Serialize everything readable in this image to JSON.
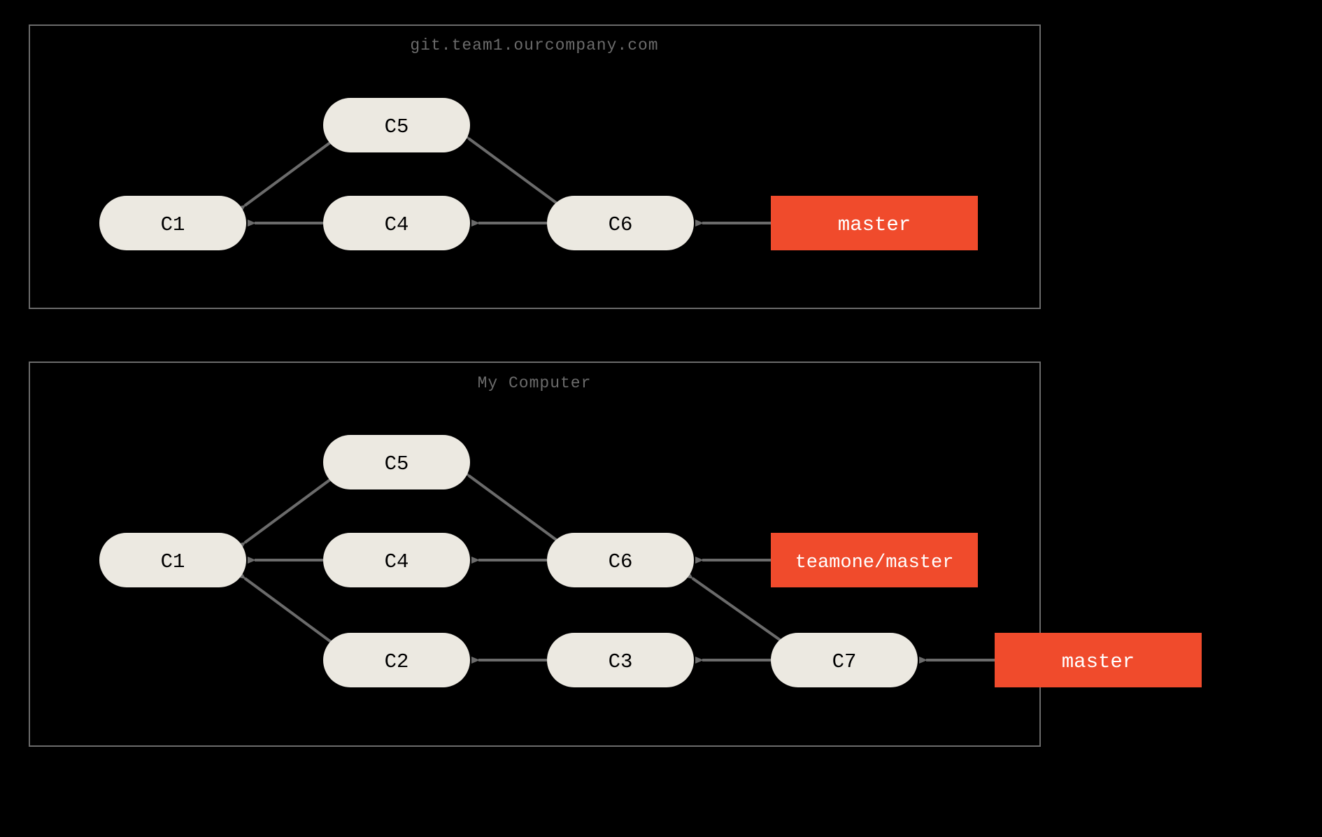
{
  "colors": {
    "background": "#000000",
    "panel_border": "#6b6b6b",
    "edge": "#6b6b6b",
    "commit_fill": "#ece9e1",
    "commit_text": "#000000",
    "branch_fill": "#f04b2c",
    "branch_text": "#ffffff",
    "title_text": "#6b6b6b"
  },
  "top_panel": {
    "title": "git.team1.ourcompany.com",
    "commits": {
      "c1": "C1",
      "c4": "C4",
      "c5": "C5",
      "c6": "C6"
    },
    "branches": {
      "master": "master"
    },
    "edges": [
      [
        "c4",
        "c1"
      ],
      [
        "c5",
        "c1"
      ],
      [
        "c6",
        "c4"
      ],
      [
        "c6",
        "c5"
      ],
      [
        "master",
        "c6"
      ]
    ]
  },
  "bottom_panel": {
    "title": "My Computer",
    "commits": {
      "c1": "C1",
      "c2": "C2",
      "c3": "C3",
      "c4": "C4",
      "c5": "C5",
      "c6": "C6",
      "c7": "C7"
    },
    "branches": {
      "teamone_master": "teamone/master",
      "master": "master"
    },
    "edges": [
      [
        "c4",
        "c1"
      ],
      [
        "c5",
        "c1"
      ],
      [
        "c2",
        "c1"
      ],
      [
        "c6",
        "c4"
      ],
      [
        "c6",
        "c5"
      ],
      [
        "c3",
        "c2"
      ],
      [
        "c7",
        "c3"
      ],
      [
        "c7",
        "c6"
      ],
      [
        "teamone_master",
        "c6"
      ],
      [
        "master",
        "c7"
      ]
    ]
  }
}
